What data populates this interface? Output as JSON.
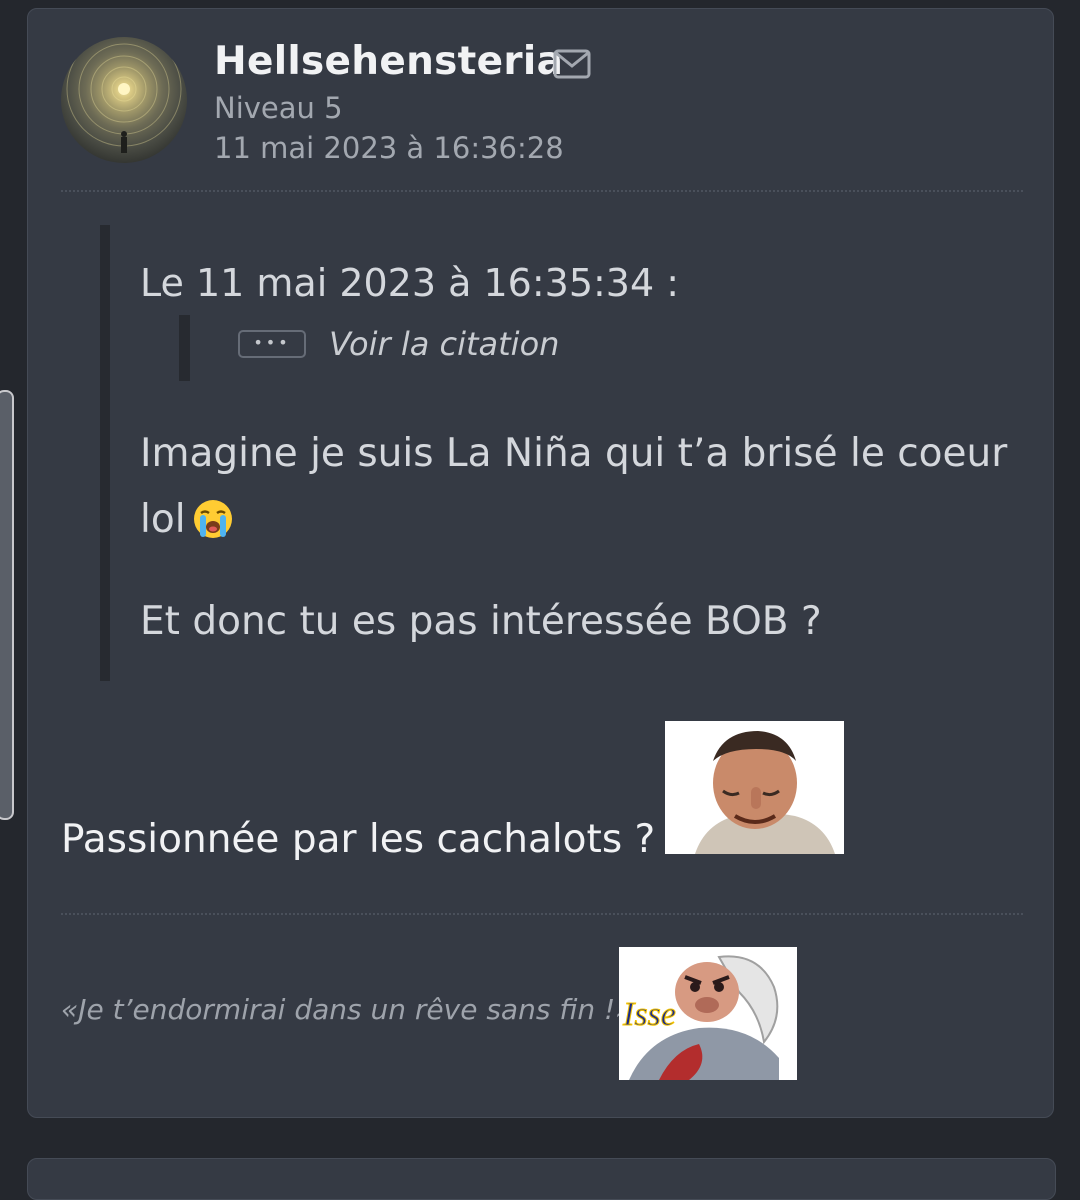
{
  "post": {
    "author": {
      "username": "Hellsehensteria",
      "level": "Niveau 5",
      "date": "11 mai 2023 à 16:36:28",
      "avatar_icon": "spiral-vision-avatar"
    },
    "quote": {
      "header": "Le 11 mai 2023 à 16:35:34 :",
      "nested_toggle_icon": "ellipsis-icon",
      "nested_toggle_label": "Voir la citation",
      "paragraphs": [
        "Imagine je suis La Niña qui t’a brisé le coeur lol",
        "Et donc tu es pas intéressée BOB ?"
      ],
      "emoji": "loudly-crying-face"
    },
    "message": "Passionnée par les cachalots ?",
    "message_sticker": "risitas-sticker",
    "signature": {
      "text": "«Je t’endormirai dans un rêve sans fin !»",
      "sticker_text": "Isse"
    }
  },
  "colors": {
    "page_bg": "#24272d",
    "card_bg": "#353a44",
    "text_primary": "#f1f2f4",
    "text_muted": "#a3a8b0"
  }
}
